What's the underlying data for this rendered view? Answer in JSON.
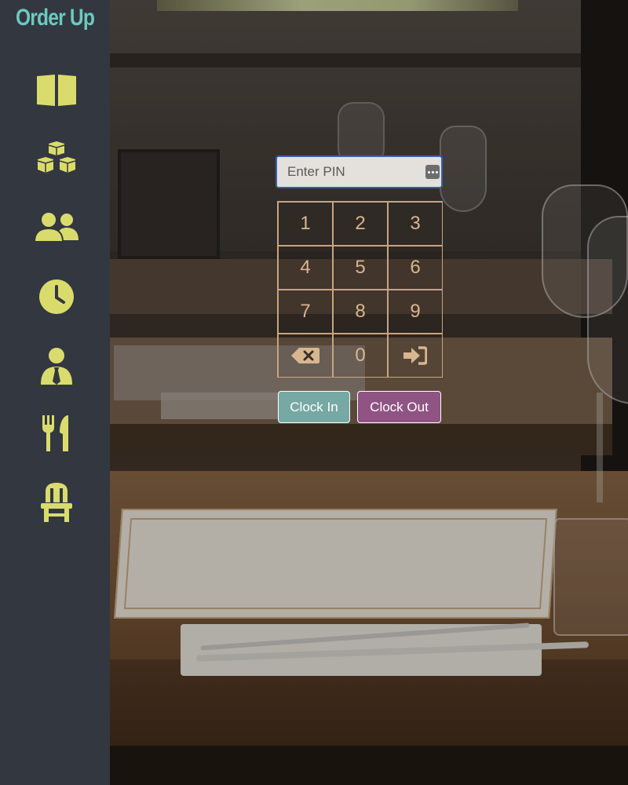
{
  "app": {
    "title": "Order Up"
  },
  "sidebar": {
    "items": [
      {
        "id": "menu",
        "icon": "book-open-icon"
      },
      {
        "id": "inventory",
        "icon": "cubes-icon"
      },
      {
        "id": "customers",
        "icon": "users-icon"
      },
      {
        "id": "time",
        "icon": "clock-icon"
      },
      {
        "id": "staff",
        "icon": "user-tie-icon"
      },
      {
        "id": "kitchen",
        "icon": "utensils-icon"
      },
      {
        "id": "tables",
        "icon": "chair-icon"
      }
    ],
    "icon_color": "#d9dc6c",
    "background": "#323740"
  },
  "pin": {
    "placeholder": "Enter PIN",
    "value": ""
  },
  "keypad": {
    "keys": [
      "1",
      "2",
      "3",
      "4",
      "5",
      "6",
      "7",
      "8",
      "9",
      "",
      "0",
      ""
    ],
    "backspace_icon": "backspace-icon",
    "submit_icon": "sign-in-icon"
  },
  "actions": {
    "clock_in": "Clock In",
    "clock_out": "Clock Out",
    "clock_in_color": "#76a8a4",
    "clock_out_color": "#8f5484"
  }
}
